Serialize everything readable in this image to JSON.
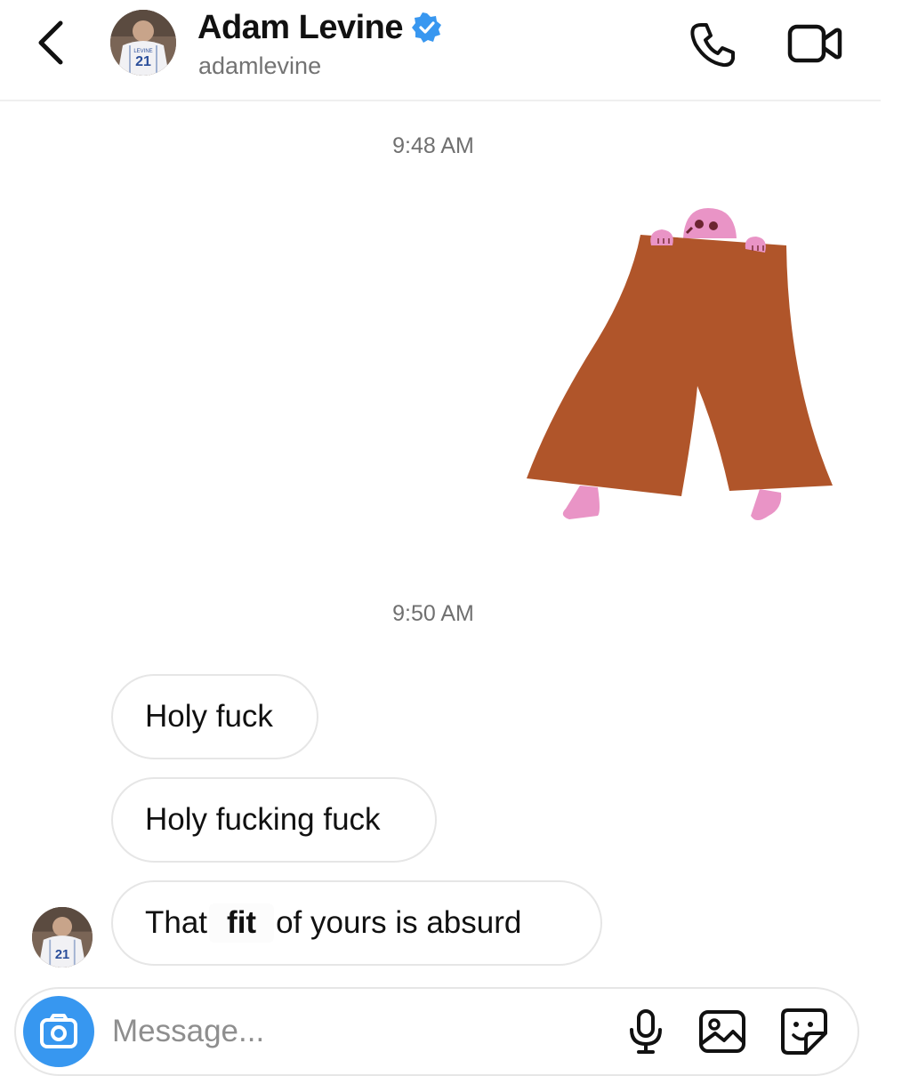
{
  "header": {
    "display_name": "Adam Levine",
    "username": "adamlevine",
    "verified": true,
    "avatar_jersey_number": "21",
    "avatar_jersey_text": "LEVINE",
    "icons": [
      "back-chevron-icon",
      "verified-badge-icon",
      "phone-icon",
      "video-camera-icon"
    ]
  },
  "thread": {
    "timestamps": [
      "9:48 AM",
      "9:50 AM"
    ],
    "sticker": "pants-character-sticker",
    "messages": [
      {
        "text": "Holy fuck"
      },
      {
        "text": "Holy fucking fuck"
      },
      {
        "before": "That",
        "highlight": "fit",
        "after": "of yours is absurd"
      }
    ]
  },
  "composer": {
    "placeholder": "Message...",
    "value": "",
    "icons": [
      "camera-icon",
      "microphone-icon",
      "gallery-icon",
      "sticker-icon"
    ]
  },
  "colors": {
    "accent": "#3797f0",
    "verified": "#3897f0",
    "pants": "#b0552a",
    "skin": "#e994c6",
    "bubble_border": "#e6e6e6",
    "secondary_text": "#737373"
  }
}
